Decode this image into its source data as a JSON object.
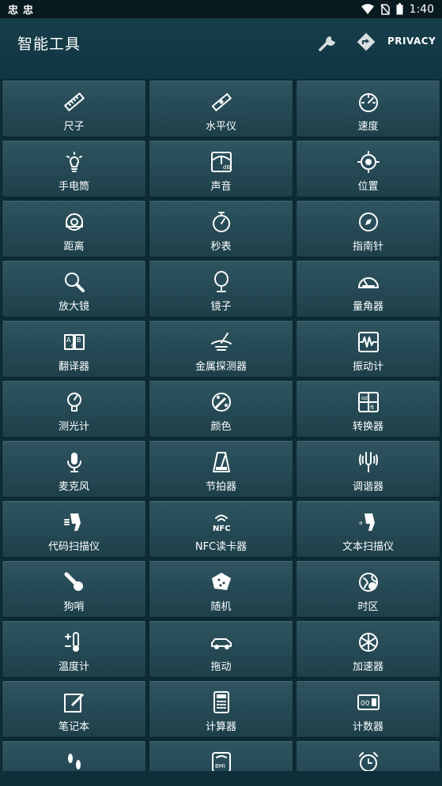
{
  "status_bar": {
    "time": "1:40",
    "left_icons": [
      "notification-icon",
      "notification-icon"
    ]
  },
  "app": {
    "title": "智能工具",
    "privacy_label": "PRIVACY"
  },
  "tools": [
    {
      "label": "尺子",
      "icon": "ruler-icon"
    },
    {
      "label": "水平仪",
      "icon": "level-icon"
    },
    {
      "label": "速度",
      "icon": "speedometer-icon"
    },
    {
      "label": "手电筒",
      "icon": "flashlight-icon"
    },
    {
      "label": "声音",
      "icon": "sound-meter-icon"
    },
    {
      "label": "位置",
      "icon": "location-icon"
    },
    {
      "label": "距离",
      "icon": "tape-measure-icon"
    },
    {
      "label": "秒表",
      "icon": "stopwatch-icon"
    },
    {
      "label": "指南针",
      "icon": "compass-icon"
    },
    {
      "label": "放大镜",
      "icon": "magnifier-icon"
    },
    {
      "label": "镜子",
      "icon": "mirror-icon"
    },
    {
      "label": "量角器",
      "icon": "protractor-icon"
    },
    {
      "label": "翻译器",
      "icon": "translator-icon"
    },
    {
      "label": "金属探测器",
      "icon": "metal-detector-icon"
    },
    {
      "label": "振动计",
      "icon": "vibration-icon"
    },
    {
      "label": "测光计",
      "icon": "light-meter-icon"
    },
    {
      "label": "颜色",
      "icon": "color-palette-icon"
    },
    {
      "label": "转换器",
      "icon": "converter-icon"
    },
    {
      "label": "麦克风",
      "icon": "microphone-icon"
    },
    {
      "label": "节拍器",
      "icon": "metronome-icon"
    },
    {
      "label": "调谐器",
      "icon": "tuner-icon"
    },
    {
      "label": "代码扫描仪",
      "icon": "barcode-scanner-icon"
    },
    {
      "label": "NFC读卡器",
      "icon": "nfc-icon"
    },
    {
      "label": "文本扫描仪",
      "icon": "text-scanner-icon"
    },
    {
      "label": "狗哨",
      "icon": "dog-whistle-icon"
    },
    {
      "label": "随机",
      "icon": "dice-icon"
    },
    {
      "label": "时区",
      "icon": "timezone-icon"
    },
    {
      "label": "温度计",
      "icon": "thermometer-icon"
    },
    {
      "label": "拖动",
      "icon": "car-icon"
    },
    {
      "label": "加速器",
      "icon": "accelerometer-icon"
    },
    {
      "label": "笔记本",
      "icon": "notebook-icon"
    },
    {
      "label": "计算器",
      "icon": "calculator-icon"
    },
    {
      "label": "计数器",
      "icon": "counter-icon"
    },
    {
      "label": "",
      "icon": "footsteps-icon"
    },
    {
      "label": "",
      "icon": "bmi-scale-icon"
    },
    {
      "label": "",
      "icon": "alarm-clock-icon"
    }
  ]
}
